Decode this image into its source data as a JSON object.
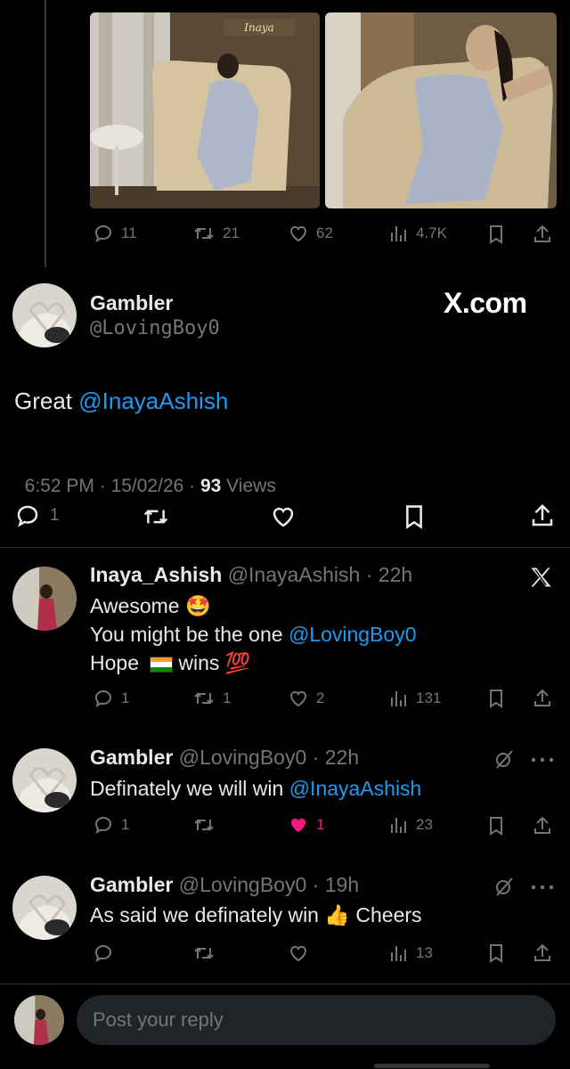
{
  "top_post": {
    "photo_watermark": "Inaya",
    "metrics": {
      "replies": "11",
      "reposts": "21",
      "likes": "62",
      "views": "4.7K"
    }
  },
  "main_post": {
    "display_name": "Gambler",
    "handle": "@LovingBoy0",
    "brand": "X.com",
    "text_prefix": "Great ",
    "mention": "@InayaAshish",
    "time": "6:52 PM",
    "sep1": " · ",
    "date": "15/02/26",
    "sep2": " · ",
    "views_count": "93",
    "views_label": " Views",
    "reply_count": "1"
  },
  "replies": [
    {
      "display_name": "Inaya_Ashish",
      "handle": "@InayaAshish",
      "time_sep": " · ",
      "time": "22h",
      "line1": "Awesome ",
      "emoji1": "🤩",
      "line2_prefix": "You might be the one ",
      "line2_mention": "@LovingBoy0",
      "line3_prefix": "Hope ",
      "line3_suffix": "wins ",
      "emoji2": "💯",
      "metrics": {
        "replies": "1",
        "reposts": "1",
        "likes": "2",
        "views": "131"
      }
    },
    {
      "display_name": "Gambler",
      "handle": "@LovingBoy0",
      "time_sep": " · ",
      "time": "22h",
      "text_prefix": "Definately we will win ",
      "mention": "@InayaAshish",
      "metrics": {
        "replies": "1",
        "likes": "1",
        "views": "23"
      }
    },
    {
      "display_name": "Gambler",
      "handle": "@LovingBoy0",
      "time_sep": " · ",
      "time": "19h",
      "text_prefix": "As said we definately win ",
      "emoji": "👍",
      "text_suffix": " Cheers",
      "metrics": {
        "views": "13"
      }
    }
  ],
  "composer": {
    "placeholder": "Post your reply"
  },
  "colors": {
    "accent": "#1d9bf0",
    "like": "#f91880",
    "muted": "#71767b",
    "background": "#000000"
  }
}
